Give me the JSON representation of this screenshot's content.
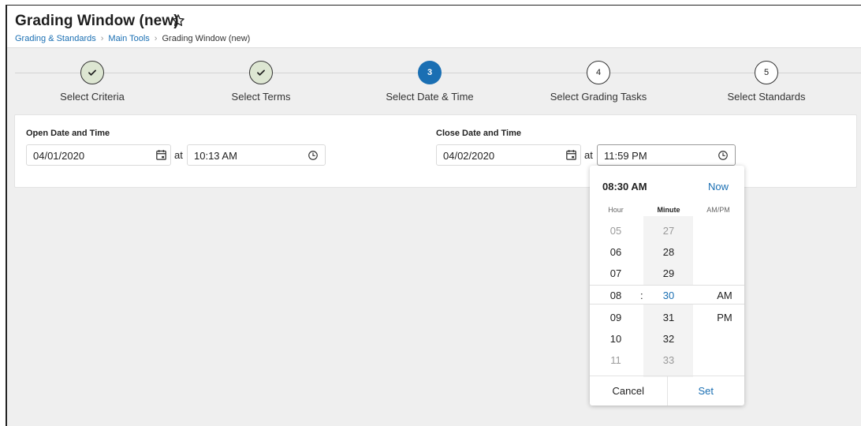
{
  "header": {
    "title": "Grading Window (new)",
    "breadcrumb": {
      "link1": "Grading & Standards",
      "link2": "Main Tools",
      "current": "Grading Window (new)"
    }
  },
  "stepper": {
    "steps": [
      {
        "label": "Select Criteria",
        "number": "1",
        "state": "done"
      },
      {
        "label": "Select Terms",
        "number": "2",
        "state": "done"
      },
      {
        "label": "Select Date & Time",
        "number": "3",
        "state": "active"
      },
      {
        "label": "Select Grading Tasks",
        "number": "4",
        "state": "pending"
      },
      {
        "label": "Select Standards",
        "number": "5",
        "state": "pending"
      }
    ]
  },
  "form": {
    "open": {
      "label": "Open Date and Time",
      "date": "04/01/2020",
      "at": "at",
      "time": "10:13 AM"
    },
    "close": {
      "label": "Close Date and Time",
      "date": "04/02/2020",
      "at": "at",
      "time": "11:59 PM"
    }
  },
  "time_picker": {
    "current": "08:30 AM",
    "now_label": "Now",
    "headers": {
      "hour": "Hour",
      "minute": "Minute",
      "ampm": "AM/PM"
    },
    "hours": [
      "05",
      "06",
      "07",
      "08",
      "09",
      "10",
      "11"
    ],
    "minutes": [
      "27",
      "28",
      "29",
      "30",
      "31",
      "32",
      "33"
    ],
    "ampm": [
      "AM",
      "PM"
    ],
    "colon": ":",
    "cancel_label": "Cancel",
    "set_label": "Set"
  },
  "colors": {
    "accent": "#1a6fb3",
    "done_fill": "#dde6d2",
    "background": "#efefef"
  }
}
